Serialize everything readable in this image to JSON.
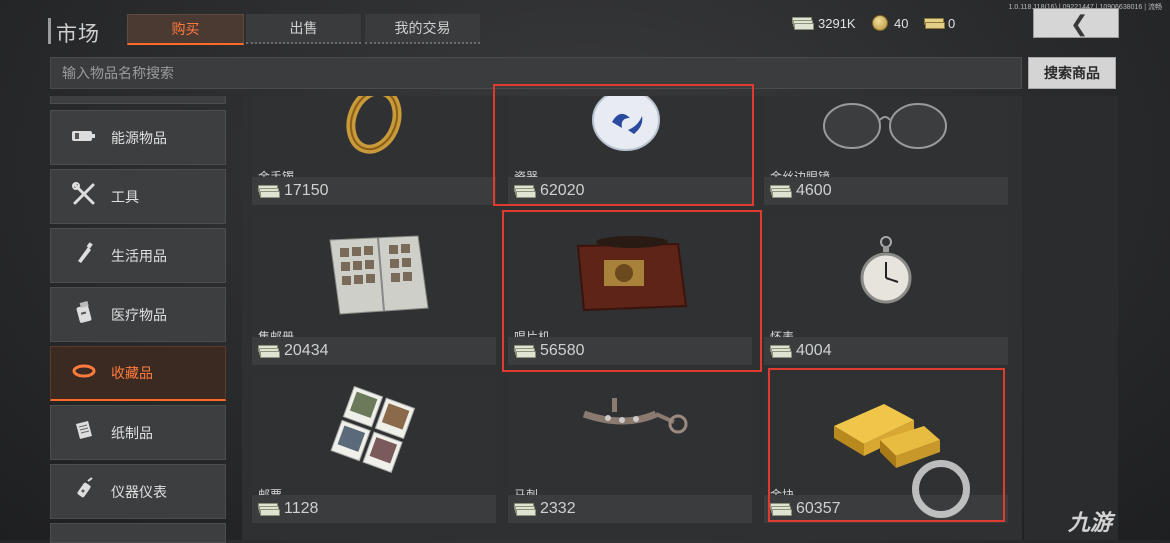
{
  "app": {
    "title": "市场",
    "version": "1.0.118.118(16) | 09221447 | 10906638016 | 流畅"
  },
  "tabs": [
    {
      "label": "购买",
      "active": true
    },
    {
      "label": "出售",
      "active": false
    },
    {
      "label": "我的交易",
      "active": false
    }
  ],
  "currency": [
    {
      "icon": "cash-icon",
      "value": "3291K"
    },
    {
      "icon": "coin-icon",
      "value": "40"
    },
    {
      "icon": "ticket-icon",
      "value": "0"
    }
  ],
  "search": {
    "placeholder": "输入物品名称搜索",
    "button": "搜索商品"
  },
  "sidebar": {
    "items": [
      {
        "label": "能源物品",
        "icon": "battery-icon",
        "active": false
      },
      {
        "label": "工具",
        "icon": "tools-icon",
        "active": false
      },
      {
        "label": "生活用品",
        "icon": "bottle-icon",
        "active": false
      },
      {
        "label": "医疗物品",
        "icon": "medicine-icon",
        "active": false
      },
      {
        "label": "收藏品",
        "icon": "ring-icon",
        "active": true
      },
      {
        "label": "纸制品",
        "icon": "book-icon",
        "active": false
      },
      {
        "label": "仪器仪表",
        "icon": "instrument-icon",
        "active": false
      }
    ]
  },
  "items": [
    {
      "name": "金手镯",
      "price": "17150",
      "image": "gold-bracelet",
      "highlighted": false
    },
    {
      "name": "瓷器",
      "price": "62020",
      "image": "porcelain-plate",
      "highlighted": true
    },
    {
      "name": "金丝边眼镜",
      "price": "4600",
      "image": "glasses",
      "highlighted": false
    },
    {
      "name": "集邮册",
      "price": "20434",
      "image": "stamp-album",
      "highlighted": false
    },
    {
      "name": "唱片机",
      "price": "56580",
      "image": "gramophone",
      "highlighted": true
    },
    {
      "name": "怀表",
      "price": "4004",
      "image": "pocket-watch",
      "highlighted": false
    },
    {
      "name": "邮票",
      "price": "1128",
      "image": "stamps",
      "highlighted": false
    },
    {
      "name": "马刺",
      "price": "2332",
      "image": "spur",
      "highlighted": false
    },
    {
      "name": "金块",
      "price": "60357",
      "image": "gold-bars",
      "highlighted": true
    }
  ],
  "colors": {
    "accent": "#ff6a2a",
    "highlight": "#e23a2e"
  },
  "watermark": {
    "text": "九游"
  }
}
